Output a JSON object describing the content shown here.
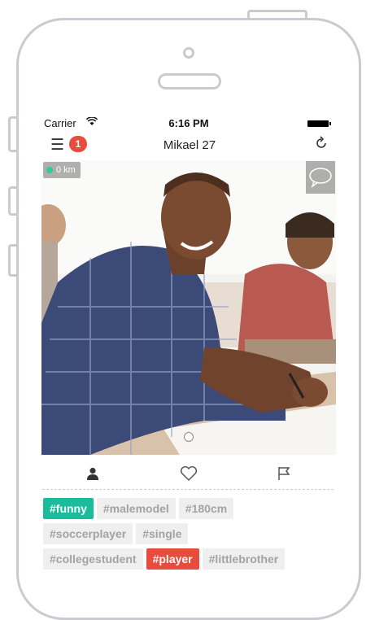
{
  "status_bar": {
    "carrier": "Carrier",
    "time": "6:16 PM"
  },
  "nav": {
    "badge_count": "1",
    "title": "Mikael 27"
  },
  "photo": {
    "distance": "0 km"
  },
  "icons": {
    "menu": "menu-icon",
    "refresh": "refresh-icon",
    "chat": "chat-bubble-icon",
    "profile": "person-icon",
    "like": "heart-icon",
    "report": "flag-icon"
  },
  "colors": {
    "accent_green": "#1bbc9b",
    "accent_red": "#e74c3c",
    "tag_gray": "#efefef"
  },
  "tags": {
    "row1": [
      "#funny",
      "#malemodel",
      "#180cm"
    ],
    "row2": [
      "#soccerplayer",
      "#single"
    ],
    "row3": [
      "#collegestudent",
      "#player",
      "#littlebrother"
    ]
  }
}
